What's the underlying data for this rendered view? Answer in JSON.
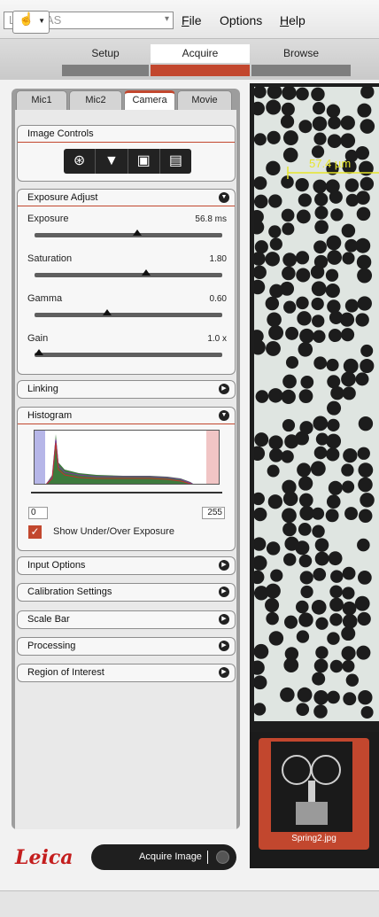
{
  "titlebar": {
    "app_name": "Leica LAS",
    "menu": [
      "File",
      "Options",
      "Help"
    ],
    "menu_accel": [
      "F",
      "",
      "H"
    ]
  },
  "workflow": {
    "steps": [
      "Setup",
      "Acquire",
      "Browse"
    ],
    "active": "Acquire"
  },
  "tabs": [
    "Mic1",
    "Mic2",
    "Camera",
    "Movie"
  ],
  "active_tab": "Camera",
  "image_controls": {
    "title": "Image Controls",
    "icons": [
      "aperture-icon",
      "illumination-icon",
      "camera-icon",
      "film-icon"
    ]
  },
  "exposure_adjust": {
    "title": "Exposure Adjust",
    "sliders": [
      {
        "label": "Exposure",
        "value": "56.8 ms",
        "position": 0.55
      },
      {
        "label": "Saturation",
        "value": "1.80",
        "position": 0.6
      },
      {
        "label": "Gamma",
        "value": "0.60",
        "position": 0.38
      },
      {
        "label": "Gain",
        "value": "1.0 x",
        "position": 0.0
      }
    ]
  },
  "linking": {
    "title": "Linking"
  },
  "histogram": {
    "title": "Histogram",
    "min": "0",
    "max": "255",
    "show_exposure_label": "Show Under/Over Exposure",
    "show_exposure_checked": true
  },
  "collapsed_sections": [
    "Input Options",
    "Calibration Settings",
    "Scale Bar",
    "Processing",
    "Region of Interest"
  ],
  "bottom": {
    "logo": "Leica",
    "acquire_label": "Acquire Image"
  },
  "viewer": {
    "scale_text": "57.4 µm",
    "thumbnail_name": "Spring2.jpg"
  },
  "colors": {
    "accent": "#c2472e",
    "scale": "#e7e52a",
    "logo": "#c41e1e"
  }
}
